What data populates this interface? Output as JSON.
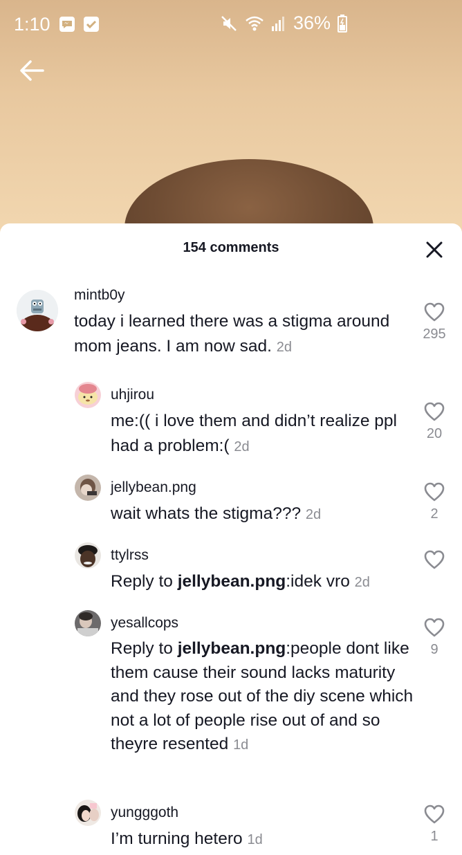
{
  "status_bar": {
    "time": "1:10",
    "battery": "36%",
    "notification_icons": [
      "messenger-icon",
      "check-icon"
    ],
    "right_icons": [
      "mute-icon",
      "wifi-icon",
      "signal-icon",
      "battery-icon"
    ]
  },
  "header": {
    "comment_count": "154 comments"
  },
  "comments": [
    {
      "username": "mintb0y",
      "text": "today i learned there was a stigma around mom jeans. I am now sad.",
      "time": "2d",
      "likes": "295"
    },
    {
      "username": "uhjirou",
      "text": "me:(( i love them and didn’t realize ppl had a problem:(",
      "time": "2d",
      "likes": "20"
    },
    {
      "username": "jellybean.png",
      "text": "wait whats the stigma???",
      "time": "2d",
      "likes": "2"
    },
    {
      "username": "ttylrss",
      "reply_prefix": "Reply to ",
      "reply_to": "jellybean.png",
      "text": ":idek vro",
      "time": "2d",
      "likes": ""
    },
    {
      "username": "yesallcops",
      "reply_prefix": "Reply to ",
      "reply_to": "jellybean.png",
      "text": ":people dont like them cause their sound lacks maturity and they rose out of the diy scene which not a lot of people rise out of and so theyre resented",
      "time": "1d",
      "likes": "9"
    },
    {
      "username": "yungggoth",
      "text": "I’m turning hetero",
      "time": "1d",
      "likes": "1"
    }
  ],
  "colors": {
    "text": "#161823",
    "secondary": "#8a8b91",
    "sheet_bg": "#ffffff"
  }
}
